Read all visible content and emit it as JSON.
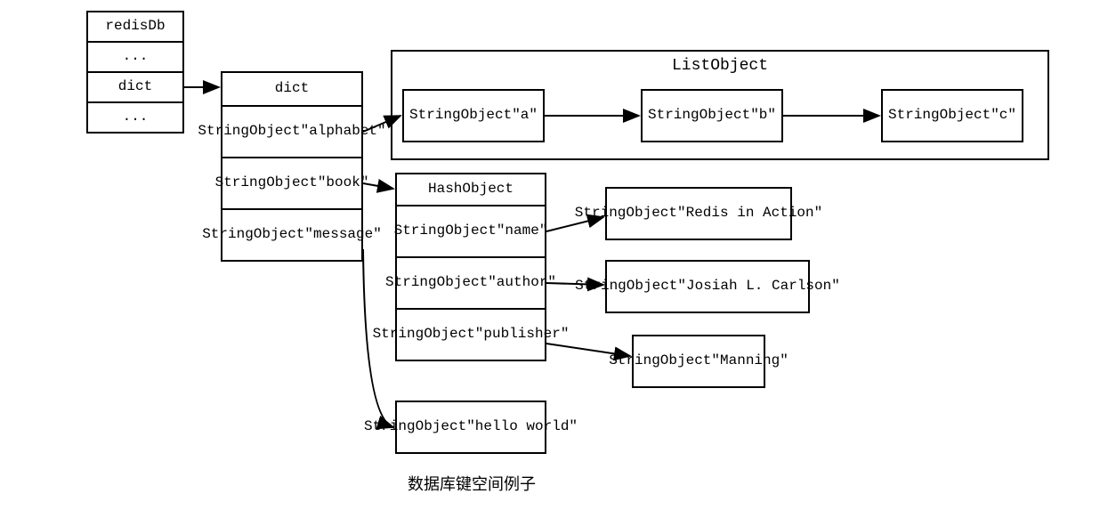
{
  "redisDb": {
    "rows": [
      "redisDb",
      "...",
      "dict",
      "..."
    ]
  },
  "dictTable": {
    "rows": [
      {
        "header": "dict"
      },
      {
        "type": "StringObject",
        "value": "\"alphabet\""
      },
      {
        "type": "StringObject",
        "value": "\"book\""
      },
      {
        "type": "StringObject",
        "value": "\"message\""
      }
    ]
  },
  "listObject": {
    "title": "ListObject",
    "items": [
      {
        "type": "StringObject",
        "value": "\"a\""
      },
      {
        "type": "StringObject",
        "value": "\"b\""
      },
      {
        "type": "StringObject",
        "value": "\"c\""
      }
    ]
  },
  "hashObject": {
    "header": "HashObject",
    "fields": [
      {
        "type": "StringObject",
        "value": "\"name\"",
        "target": {
          "type": "StringObject",
          "value": "\"Redis in Action\""
        }
      },
      {
        "type": "StringObject",
        "value": "\"author\"",
        "target": {
          "type": "StringObject",
          "value": "\"Josiah L. Carlson\""
        }
      },
      {
        "type": "StringObject",
        "value": "\"publisher\"",
        "target": {
          "type": "StringObject",
          "value": "\"Manning\""
        }
      }
    ]
  },
  "messageValue": {
    "type": "StringObject",
    "value": "\"hello world\""
  },
  "caption": "数据库键空间例子"
}
